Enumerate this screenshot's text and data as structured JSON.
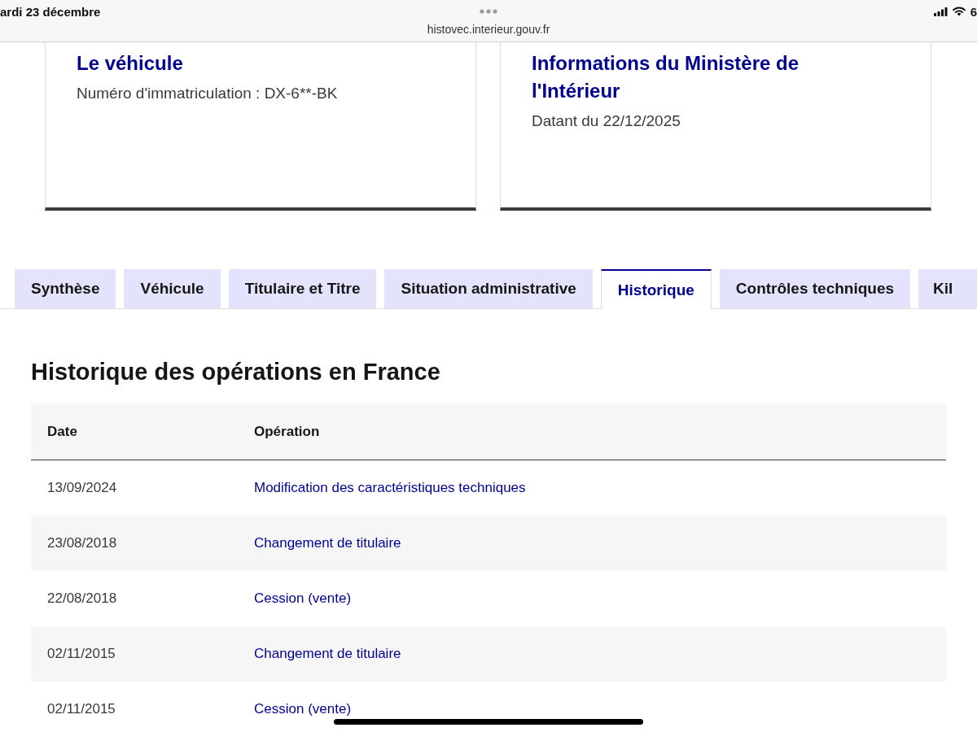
{
  "status_bar": {
    "date": "ardi 23 décembre",
    "url": "histovec.interieur.gouv.fr",
    "battery": "6"
  },
  "cards": [
    {
      "title": "Le véhicule",
      "text": "Numéro d'immatriculation : DX-6**-BK"
    },
    {
      "title": "Informations du Ministère de l'Intérieur",
      "text": "Datant du 22/12/2025"
    }
  ],
  "tabs": [
    {
      "label": "Synthèse",
      "selected": false
    },
    {
      "label": "Véhicule",
      "selected": false
    },
    {
      "label": "Titulaire et Titre",
      "selected": false
    },
    {
      "label": "Situation administrative",
      "selected": false
    },
    {
      "label": "Historique",
      "selected": true
    },
    {
      "label": "Contrôles techniques",
      "selected": false
    },
    {
      "label": "Kil",
      "selected": false
    }
  ],
  "history": {
    "title": "Historique des opérations en France",
    "columns": [
      "Date",
      "Opération"
    ],
    "rows": [
      {
        "date": "13/09/2024",
        "operation": "Modification des caractéristiques techniques"
      },
      {
        "date": "23/08/2018",
        "operation": "Changement de titulaire"
      },
      {
        "date": "22/08/2018",
        "operation": "Cession (vente)"
      },
      {
        "date": "02/11/2015",
        "operation": "Changement de titulaire"
      },
      {
        "date": "02/11/2015",
        "operation": "Cession (vente)"
      }
    ]
  }
}
